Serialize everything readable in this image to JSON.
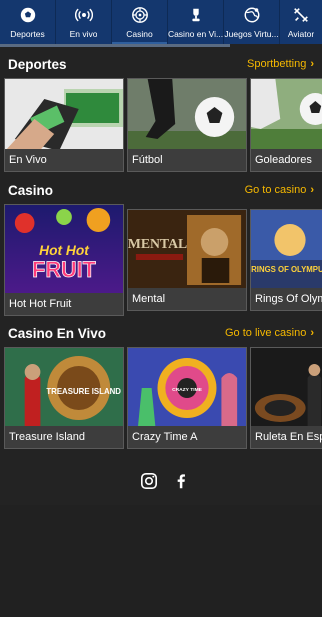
{
  "nav": [
    {
      "label": "Deportes",
      "icon": "soccer-ball-icon"
    },
    {
      "label": "En vivo",
      "icon": "live-signal-icon"
    },
    {
      "label": "Casino",
      "icon": "roulette-icon"
    },
    {
      "label": "Casino en Vi...",
      "icon": "trophy-icon"
    },
    {
      "label": "Juegos Virtu...",
      "icon": "globe-icon"
    },
    {
      "label": "Aviator",
      "icon": "plane-icon"
    }
  ],
  "sections": {
    "deportes": {
      "title": "Deportes",
      "link": "Sportbetting",
      "cards": [
        "En Vivo",
        "Fútbol",
        "Goleadores"
      ]
    },
    "casino": {
      "title": "Casino",
      "link": "Go to casino",
      "cards": [
        "Hot Hot Fruit",
        "Mental",
        "Rings Of Olympus"
      ],
      "art": {
        "hot_fruit_line1": "Hot Hot",
        "hot_fruit_line2": "FRUIT",
        "mental": "MENTAL",
        "rings": "RINGS OF OLYMPUS"
      }
    },
    "casino_vivo": {
      "title": "Casino En Vivo",
      "link": "Go to live casino",
      "cards": [
        "Treasure Island",
        "Crazy Time A",
        "Ruleta En Español"
      ],
      "art": {
        "treasure": "TREASURE ISLAND",
        "crazy": "CRAZY TIME"
      }
    }
  },
  "colors": {
    "nav_bg": "#14376e",
    "accent": "#f5b800",
    "page_bg": "#232323"
  },
  "social": [
    "instagram-icon",
    "facebook-icon"
  ]
}
